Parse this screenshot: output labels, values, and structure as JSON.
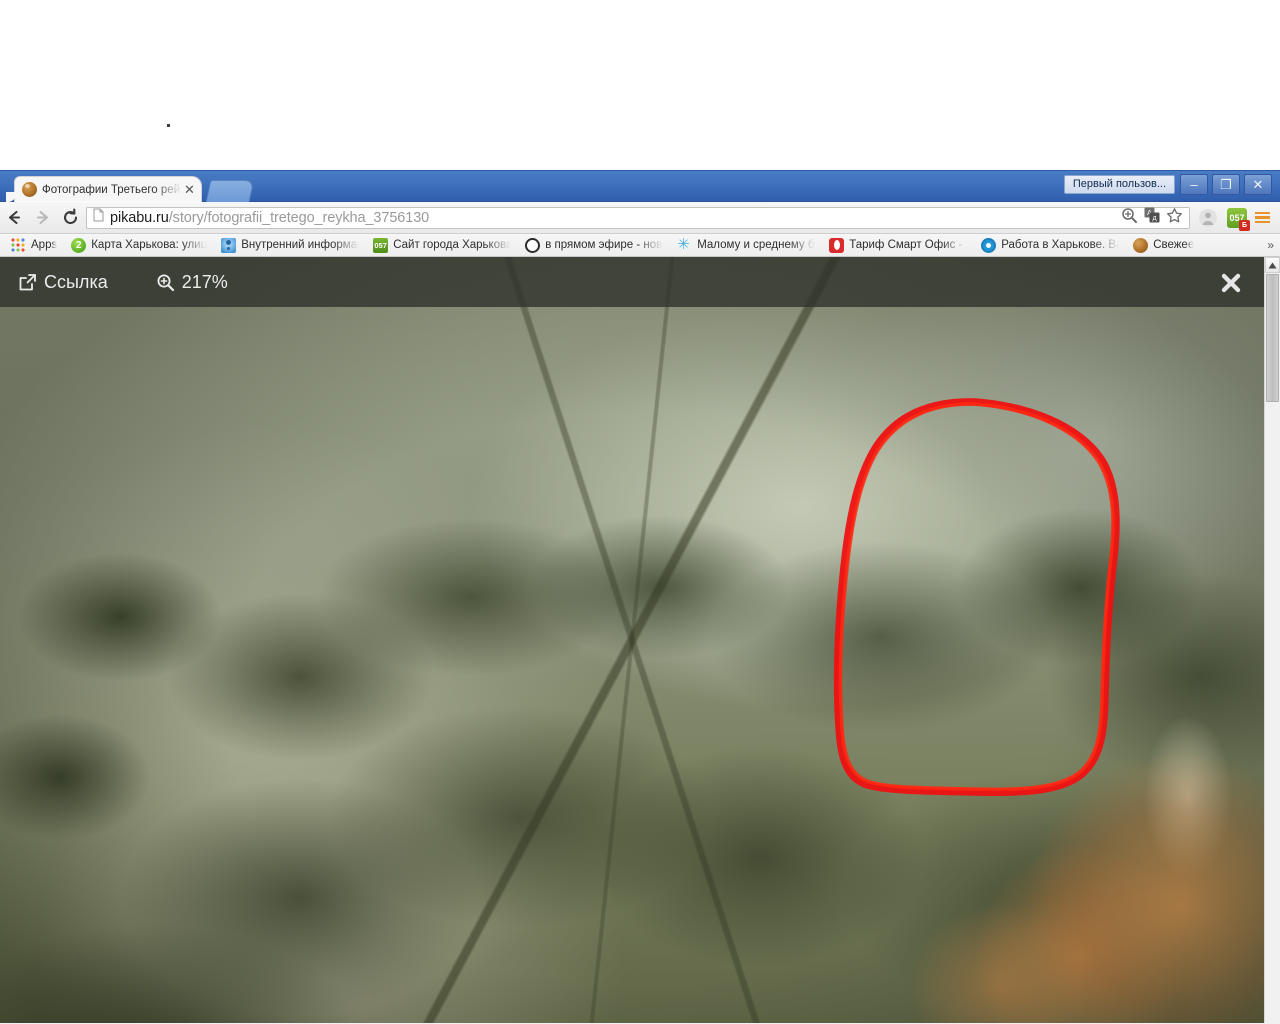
{
  "window": {
    "user_button_label": "Первый пользов...",
    "minimize_label": "–",
    "maximize_label": "❐",
    "close_label": "✕"
  },
  "tab": {
    "title": "Фотографии Третьего рей",
    "close_label": "✕",
    "favicon_name": "pikabu-favicon"
  },
  "nav": {
    "back_icon": "back-arrow-icon",
    "forward_icon": "forward-arrow-icon",
    "reload_icon": "reload-icon"
  },
  "omnibox": {
    "url_domain": "pikabu.ru",
    "url_path": "/story/fotografii_tretego_reykha_3756130",
    "full_url": "pikabu.ru/story/fotografii_tretego_reykha_3756130",
    "page_icon": "page-document-icon",
    "zoom_icon": "zoom-magnifier-icon",
    "translate_icon": "translate-icon",
    "bookmark_icon": "star-outline-icon"
  },
  "toolbar_right": {
    "profile_icon": "person-silhouette-icon",
    "extension_057_label": "057",
    "extension_057_badge": "Б",
    "menu_icon": "hamburger-menu-icon"
  },
  "bookmarks": {
    "overflow_label": "»",
    "items": [
      {
        "label": "Apps",
        "icon": "apps-grid-icon"
      },
      {
        "label": "Карта Харькова: улиц",
        "icon": "map-2gis-icon",
        "icon_text": "2"
      },
      {
        "label": "Внутренний информац",
        "icon": "people-icon"
      },
      {
        "label": "Сайт города Харькова",
        "icon": "057-icon",
        "icon_text": "057"
      },
      {
        "label": "в прямом эфире - новос",
        "icon": "circle-dark-icon"
      },
      {
        "label": "Малому и среднему би",
        "icon": "star-burst-icon"
      },
      {
        "label": "Тариф Смарт Офис - М",
        "icon": "opera-red-icon"
      },
      {
        "label": "Работа в Харькове. Ва",
        "icon": "target-blue-icon"
      },
      {
        "label": "Свежее",
        "icon": "pikabu-icon"
      }
    ]
  },
  "viewer": {
    "link_label": "Ссылка",
    "link_icon": "external-link-icon",
    "zoom_label": "217%",
    "zoom_icon": "zoom-in-magnifier-icon",
    "close_icon": "close-x-icon",
    "image_alt": "Цветная историческая фотография: деревья и листва, каменная стена из мешков с песком справа, оранжевое пламя внизу; красным от руки обведён фрагмент"
  },
  "annotation": {
    "color": "#ee1111",
    "shape": "hand-drawn-oval",
    "description": "Красная обводка от руки вокруг участка снимка"
  },
  "scrollbar": {
    "up_arrow": "▲"
  },
  "colors": {
    "titlebar_blue": "#3f70bd",
    "accent_orange": "#e8922a",
    "annotation_red": "#ee1111",
    "photo_olive": "#7d7f68"
  }
}
